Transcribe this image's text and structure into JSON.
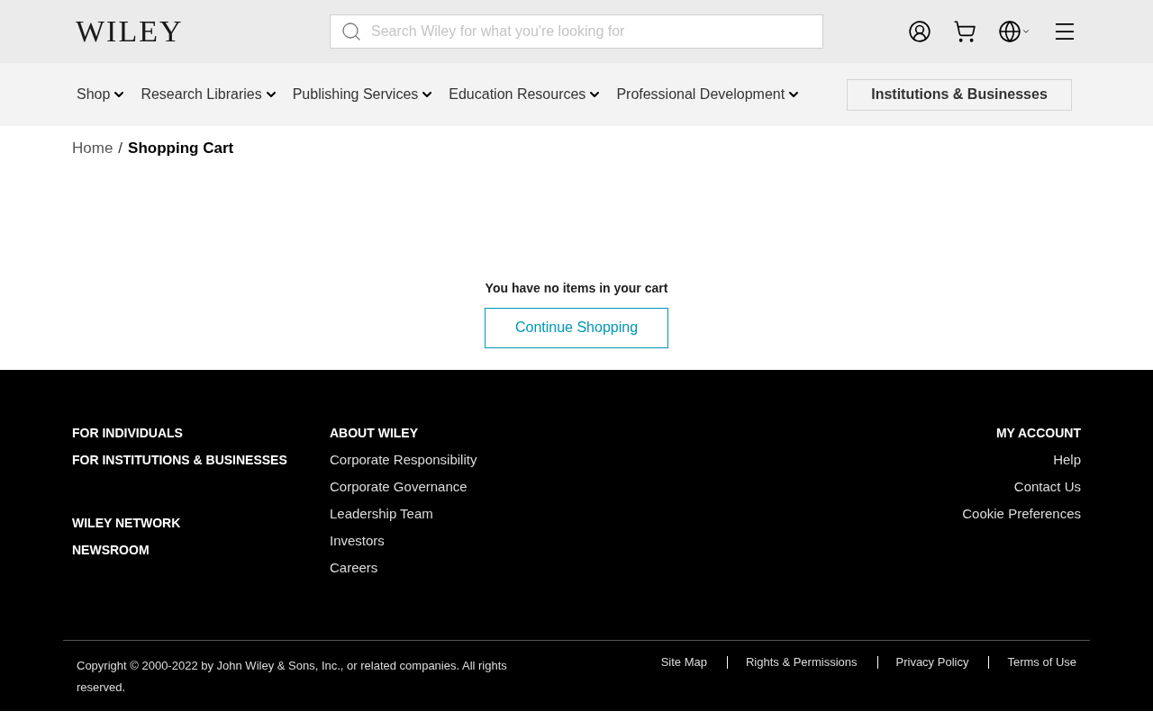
{
  "header": {
    "logo": "WILEY",
    "search": {
      "placeholder": "Search Wiley for what you're looking for"
    }
  },
  "nav": {
    "items": [
      {
        "label": "Shop"
      },
      {
        "label": "Research Libraries"
      },
      {
        "label": "Publishing Services"
      },
      {
        "label": "Education Resources"
      },
      {
        "label": "Professional Development"
      }
    ],
    "cta": "Institutions & Businesses"
  },
  "breadcrumb": [
    {
      "label": "Home",
      "current": false
    },
    {
      "label": "Shopping Cart",
      "current": true
    }
  ],
  "breadcrumb_separator": "/",
  "cart": {
    "message": "You have no items in your cart",
    "button": "Continue Shopping"
  },
  "footer": {
    "column_1": [
      "FOR INDIVIDUALS",
      "FOR INSTITUTIONS & BUSINESSES",
      "WILEY NETWORK",
      "NEWSROOM"
    ],
    "column_2": {
      "heading": "ABOUT WILEY",
      "links": [
        "Corporate Responsibility",
        "Corporate Governance",
        "Leadership Team",
        "Investors",
        "Careers"
      ]
    },
    "column_3": {
      "heading": "MY ACCOUNT",
      "links": [
        "Help",
        "Contact Us",
        "Cookie Preferences"
      ]
    },
    "copyright": "Copyright © 2000-2022 by John Wiley & Sons, Inc., or related companies. All rights reserved.",
    "legal_links": [
      "Site Map",
      "Rights & Permissions",
      "Privacy Policy",
      "Terms of Use"
    ]
  }
}
